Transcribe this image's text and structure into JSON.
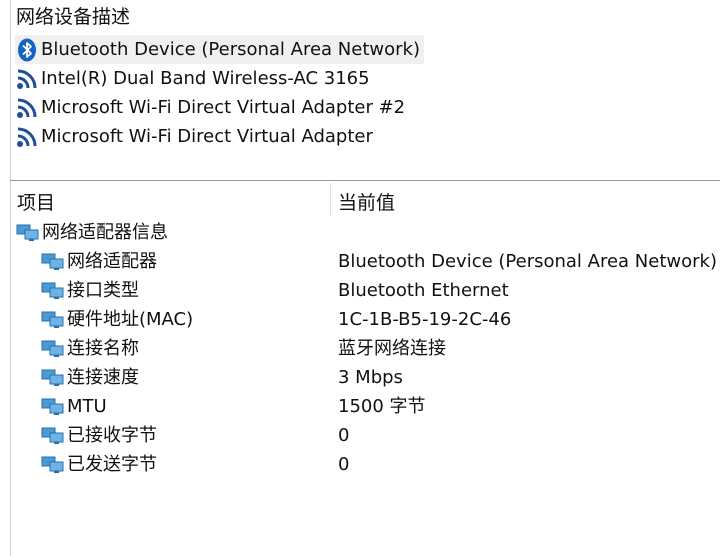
{
  "device_list": {
    "header": "网络设备描述",
    "items": [
      {
        "label": "Bluetooth Device (Personal Area Network)",
        "icon": "bluetooth-icon",
        "selected": true
      },
      {
        "label": "Intel(R) Dual Band Wireless-AC 3165",
        "icon": "wifi-icon"
      },
      {
        "label": "Microsoft Wi-Fi Direct Virtual Adapter #2",
        "icon": "wifi-icon"
      },
      {
        "label": "Microsoft Wi-Fi Direct Virtual Adapter",
        "icon": "wifi-icon"
      }
    ]
  },
  "table": {
    "col_item": "项目",
    "col_value": "当前值",
    "group": {
      "label": "网络适配器信息",
      "icon": "network-adapter-icon"
    },
    "rows": [
      {
        "name": "网络适配器",
        "value": "Bluetooth Device (Personal Area Network)"
      },
      {
        "name": "接口类型",
        "value": "Bluetooth Ethernet"
      },
      {
        "name": "硬件地址(MAC)",
        "value": "1C-1B-B5-19-2C-46"
      },
      {
        "name": "连接名称",
        "value": "蓝牙网络连接"
      },
      {
        "name": "连接速度",
        "value": "3 Mbps"
      },
      {
        "name": "MTU",
        "value": "1500 字节"
      },
      {
        "name": "已接收字节",
        "value": "0"
      },
      {
        "name": "已发送字节",
        "value": "0"
      }
    ]
  },
  "colors": {
    "bluetooth": "#1565c0",
    "wifi": "#1f4e9c",
    "network_icon": "#4a9ad4"
  }
}
